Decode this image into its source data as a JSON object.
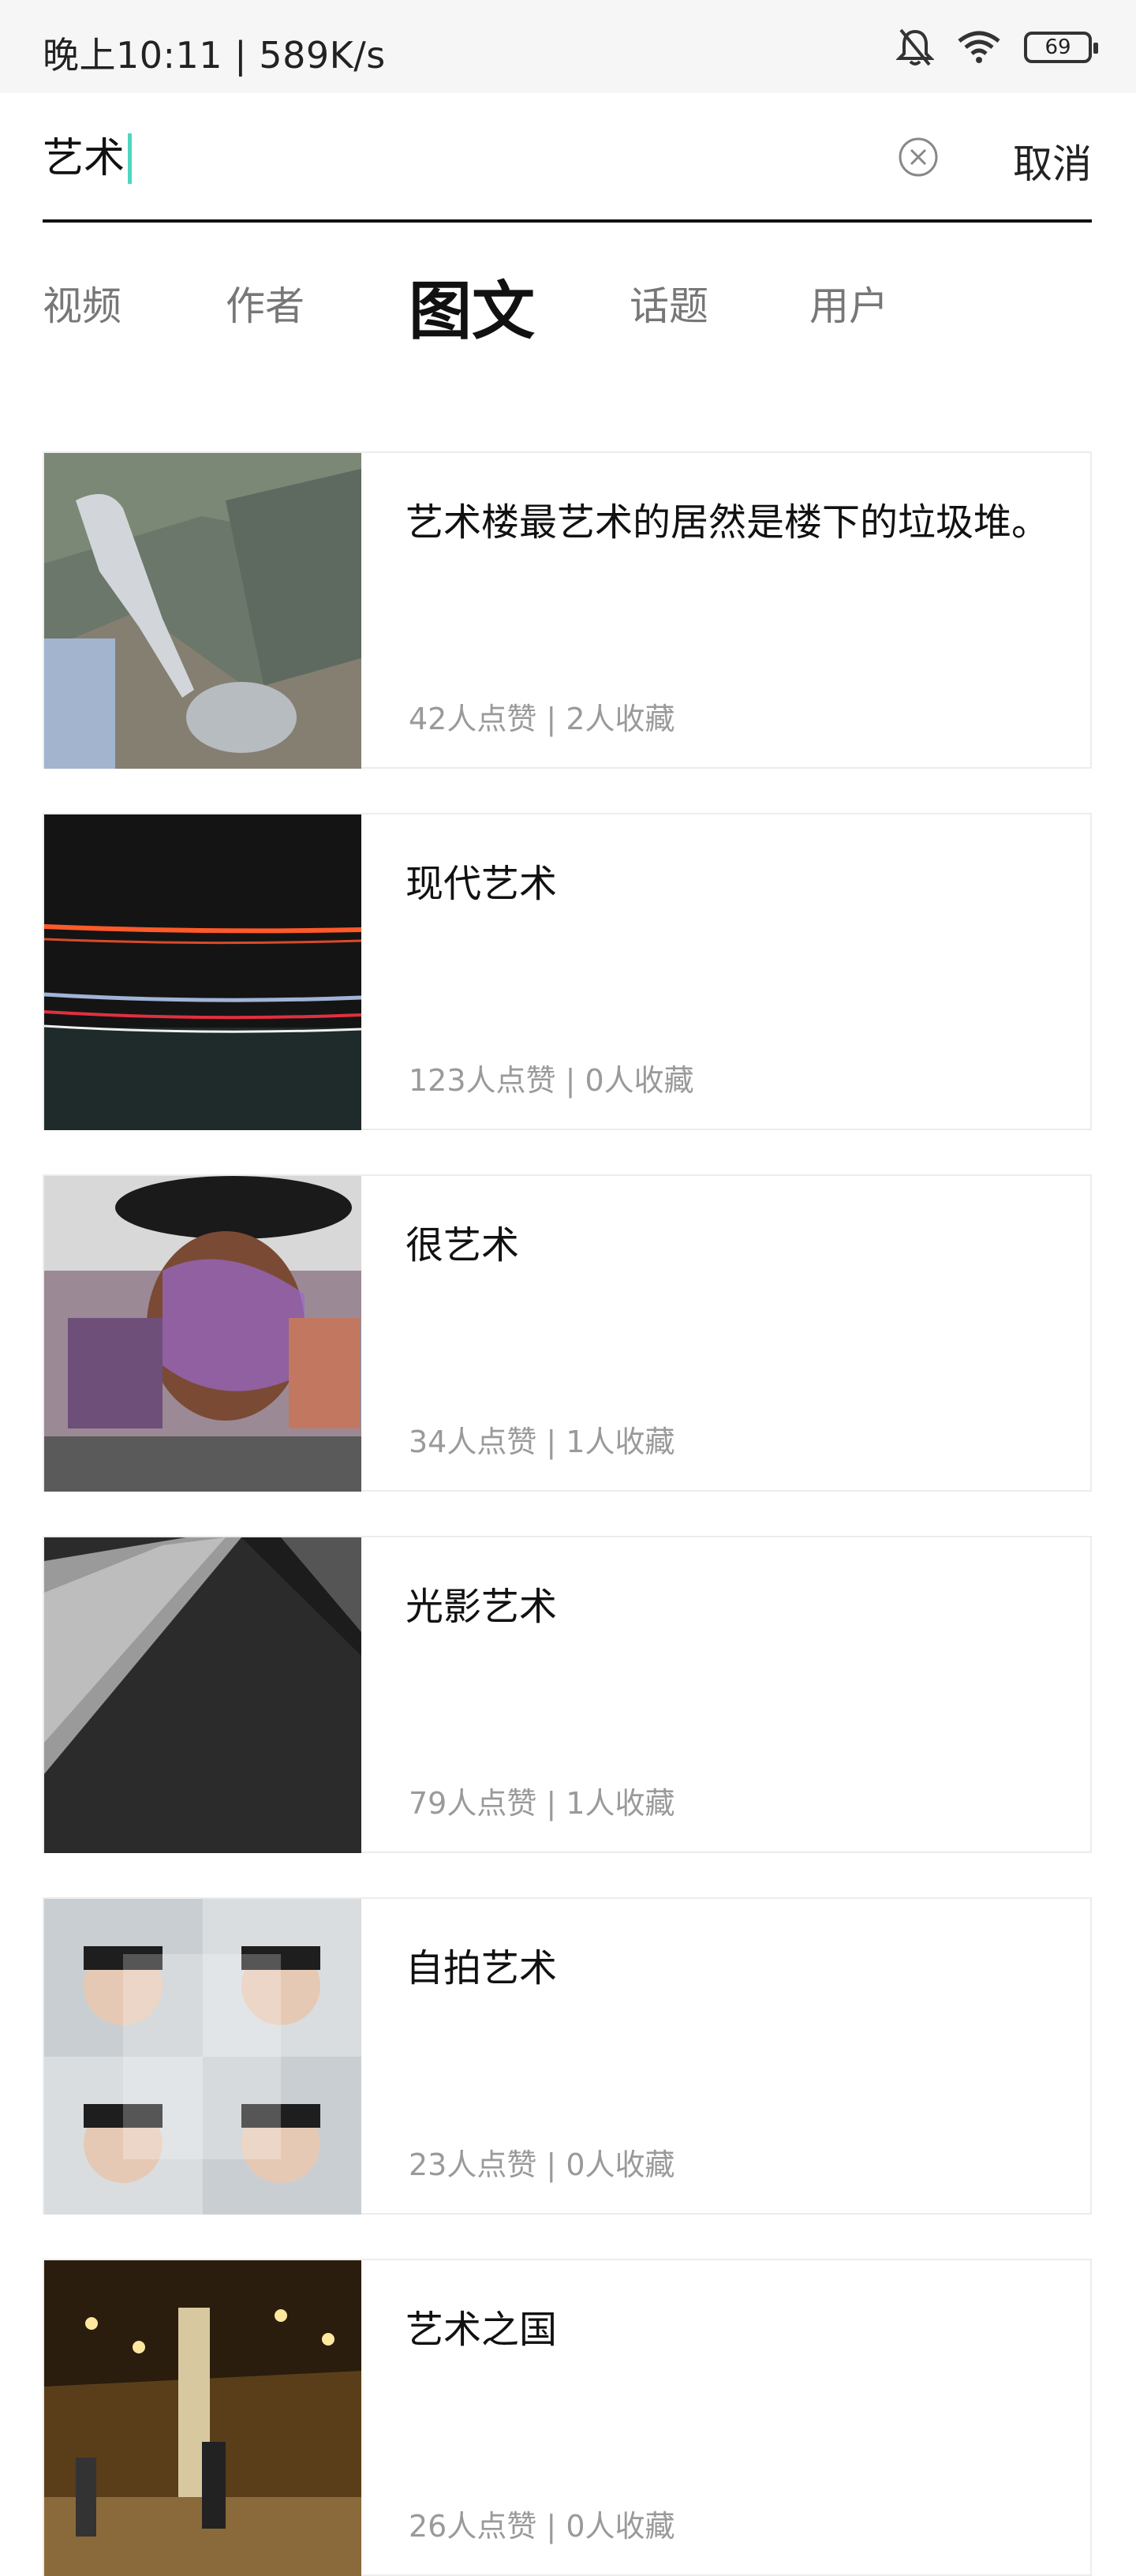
{
  "status_bar": {
    "time_speed": "晚上10:11 | 589K/s",
    "battery": "69",
    "icons": [
      "bell-muted-icon",
      "wifi-icon",
      "battery-icon"
    ]
  },
  "search": {
    "value": "艺术",
    "clear_icon": "clear-circle-icon",
    "cancel_label": "取消"
  },
  "tabs": [
    {
      "label": "视频"
    },
    {
      "label": "作者"
    },
    {
      "label": "图文",
      "active": true
    },
    {
      "label": "话题"
    },
    {
      "label": "用户"
    }
  ],
  "results": [
    {
      "title": "艺术楼最艺术的居然是楼下的垃圾堆。",
      "meta": "42人点赞 | 2人收藏",
      "multi_image": false
    },
    {
      "title": "现代艺术",
      "meta": "123人点赞 | 0人收藏",
      "multi_image": true
    },
    {
      "title": "很艺术",
      "meta": "34人点赞 | 1人收藏",
      "multi_image": false
    },
    {
      "title": "光影艺术",
      "meta": "79人点赞 | 1人收藏",
      "multi_image": true
    },
    {
      "title": "自拍艺术",
      "meta": "23人点赞 | 0人收藏",
      "multi_image": true
    },
    {
      "title": "艺术之国",
      "meta": "26人点赞 | 0人收藏",
      "multi_image": true
    }
  ]
}
